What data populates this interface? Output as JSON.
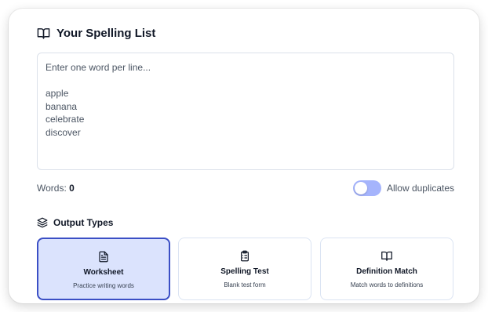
{
  "spelling_list": {
    "title": "Your Spelling List",
    "icon": "book-open-icon",
    "textarea_placeholder": "Enter one word per line...",
    "textarea_value": "Enter one word per line...\n\napple\nbanana\ncelebrate\ndiscover",
    "words_label": "Words:",
    "words_count": "0",
    "allow_duplicates": {
      "label": "Allow duplicates",
      "enabled": false
    }
  },
  "output_types": {
    "title": "Output Types",
    "icon": "layers-icon",
    "options": [
      {
        "title": "Worksheet",
        "description": "Practice writing words",
        "icon": "file-text-icon",
        "selected": true
      },
      {
        "title": "Spelling Test",
        "description": "Blank test form",
        "icon": "clipboard-list-icon",
        "selected": false
      },
      {
        "title": "Definition Match",
        "description": "Match words to definitions",
        "icon": "book-open-icon",
        "selected": false
      }
    ]
  },
  "colors": {
    "accent": "#3b4fc5",
    "selected_bg": "#dbe3fd",
    "toggle_off": "#a5b4fc",
    "border": "#dbe1ea"
  }
}
